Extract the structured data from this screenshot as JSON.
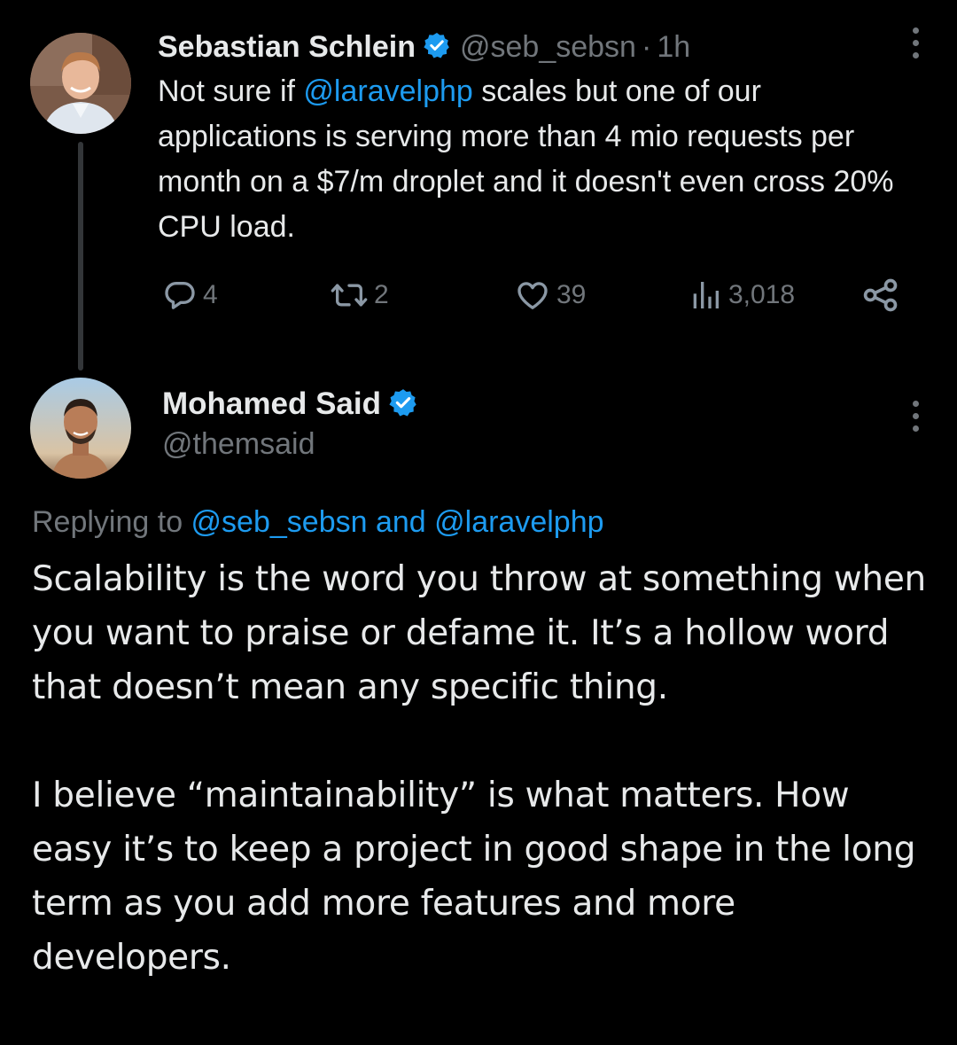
{
  "colors": {
    "background": "#000000",
    "text": "#e7e9ea",
    "muted": "#71767b",
    "link": "#1d9bf0",
    "verified": "#1d9bf0",
    "thread_line": "#333639"
  },
  "parent_tweet": {
    "author_name": "Sebastian Schlein",
    "verified_icon": "verified-badge-icon",
    "handle": "@seb_sebsn",
    "separator": "·",
    "time": "1h",
    "text_before_mention": "Not sure if ",
    "mention": "@laravelphp",
    "text_after_mention": " scales but one of our applications is serving more than 4 mio requests per month on a $7/m droplet and it doesn't even cross 20% CPU load.",
    "actions": {
      "replies": "4",
      "retweets": "2",
      "likes": "39",
      "views": "3,018"
    },
    "icons": [
      "reply-icon",
      "retweet-icon",
      "like-icon",
      "views-icon",
      "share-icon",
      "more-icon"
    ]
  },
  "reply_tweet": {
    "author_name": "Mohamed Said",
    "verified_icon": "verified-badge-icon",
    "handle": "@themsaid",
    "replying_prefix": "Replying to ",
    "replying_mentions": "@seb_sebsn and @laravelphp",
    "paragraph_1": "Scalability is the word you throw at something when you want to praise or defame it. It’s a hollow word that doesn’t mean any specific thing.",
    "paragraph_2": "I believe “maintainability” is what matters. How easy it’s to keep a project in good shape in the long term as you add more features and more developers."
  }
}
